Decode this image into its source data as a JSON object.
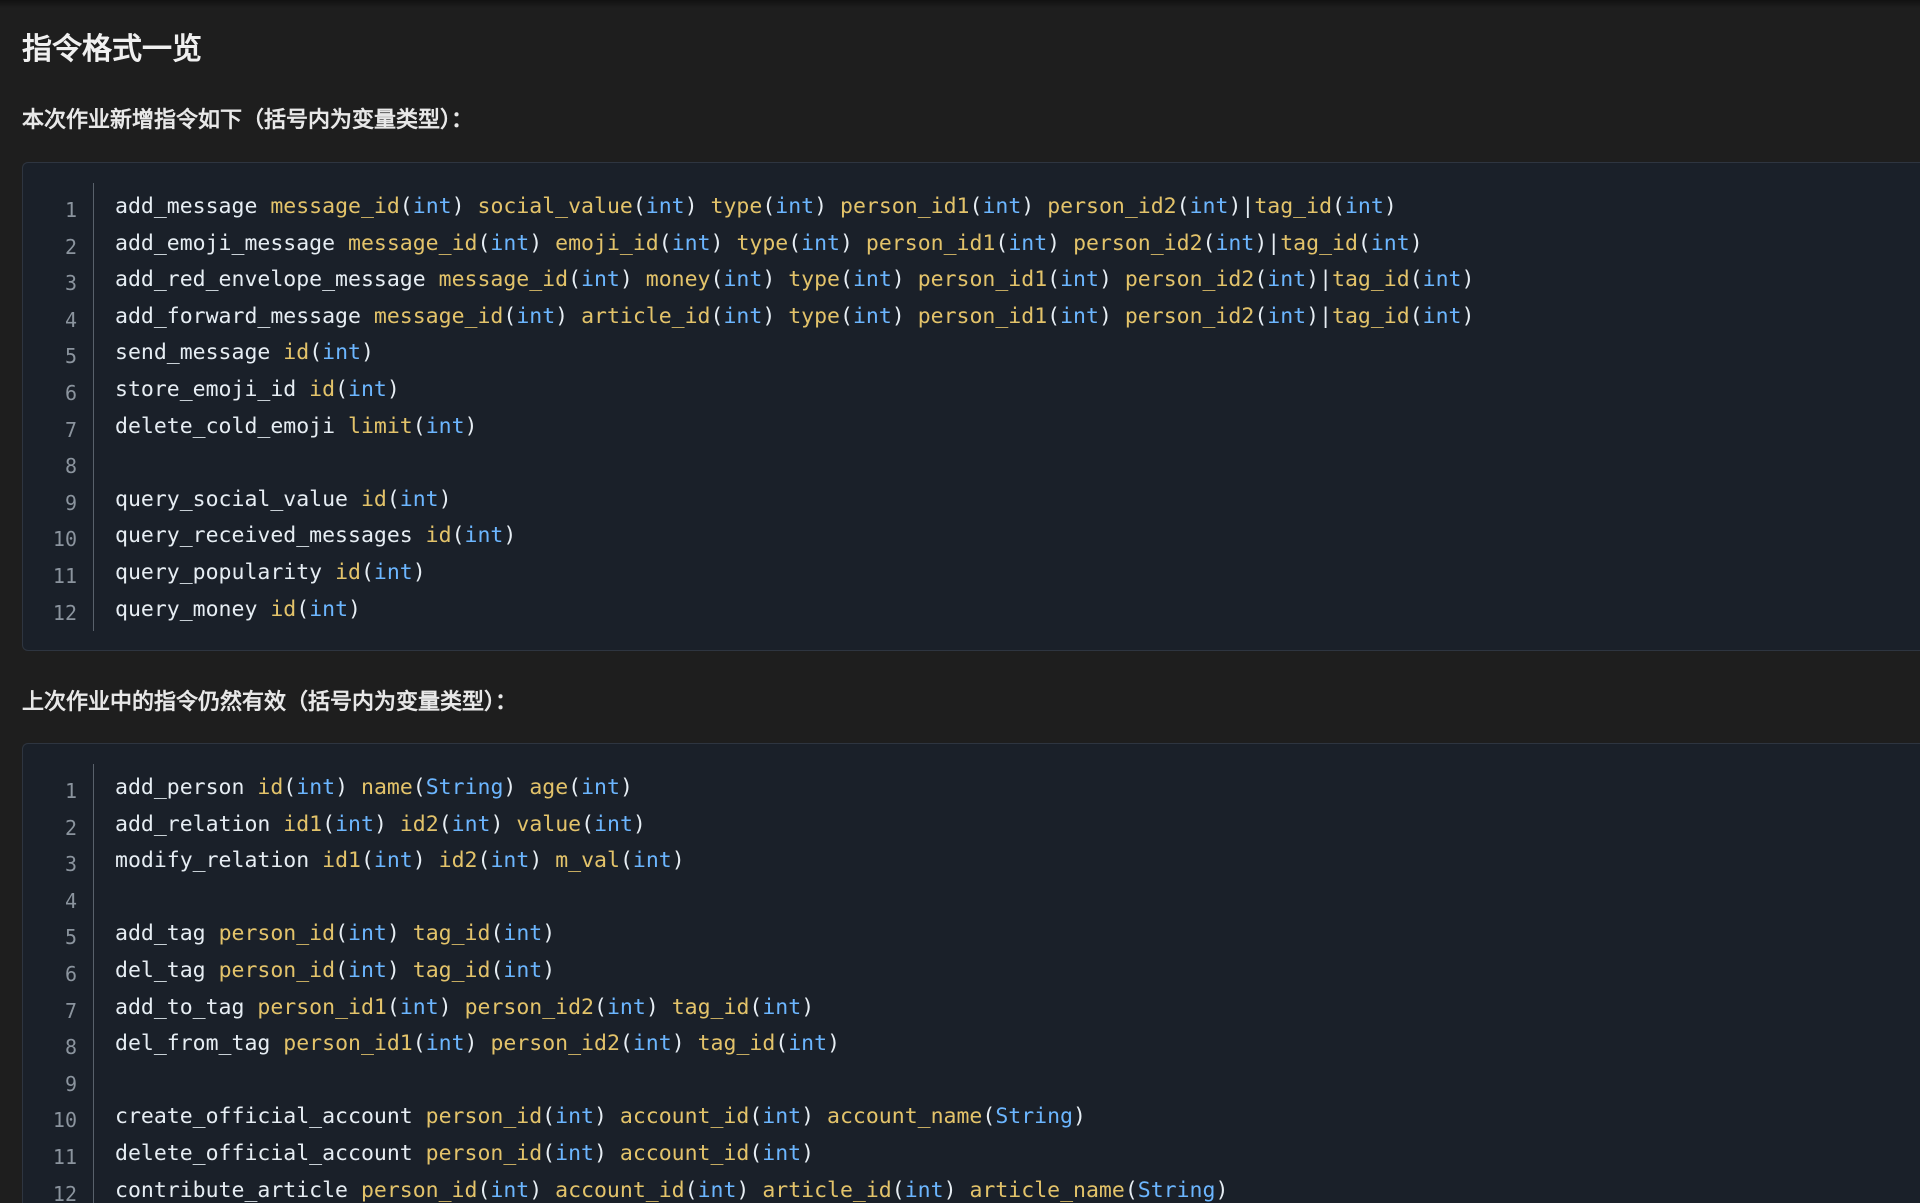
{
  "page": {
    "title": "指令格式一览"
  },
  "sections": [
    {
      "heading": "本次作业新增指令如下（括号内为变量类型）：",
      "lines": [
        {
          "n": "1",
          "cmd": "add_message",
          "args": [
            {
              "sep": " ",
              "name": "message_id",
              "type": "int"
            },
            {
              "sep": " ",
              "name": "social_value",
              "type": "int"
            },
            {
              "sep": " ",
              "name": "type",
              "type": "int"
            },
            {
              "sep": " ",
              "name": "person_id1",
              "type": "int"
            },
            {
              "sep": " ",
              "name": "person_id2",
              "type": "int"
            },
            {
              "sep": "|",
              "name": "tag_id",
              "type": "int"
            }
          ]
        },
        {
          "n": "2",
          "cmd": "add_emoji_message",
          "args": [
            {
              "sep": " ",
              "name": "message_id",
              "type": "int"
            },
            {
              "sep": " ",
              "name": "emoji_id",
              "type": "int"
            },
            {
              "sep": " ",
              "name": "type",
              "type": "int"
            },
            {
              "sep": " ",
              "name": "person_id1",
              "type": "int"
            },
            {
              "sep": " ",
              "name": "person_id2",
              "type": "int"
            },
            {
              "sep": "|",
              "name": "tag_id",
              "type": "int"
            }
          ]
        },
        {
          "n": "3",
          "cmd": "add_red_envelope_message",
          "args": [
            {
              "sep": " ",
              "name": "message_id",
              "type": "int"
            },
            {
              "sep": " ",
              "name": "money",
              "type": "int"
            },
            {
              "sep": " ",
              "name": "type",
              "type": "int"
            },
            {
              "sep": " ",
              "name": "person_id1",
              "type": "int"
            },
            {
              "sep": " ",
              "name": "person_id2",
              "type": "int"
            },
            {
              "sep": "|",
              "name": "tag_id",
              "type": "int"
            }
          ]
        },
        {
          "n": "4",
          "cmd": "add_forward_message",
          "args": [
            {
              "sep": " ",
              "name": "message_id",
              "type": "int"
            },
            {
              "sep": " ",
              "name": "article_id",
              "type": "int"
            },
            {
              "sep": " ",
              "name": "type",
              "type": "int"
            },
            {
              "sep": " ",
              "name": "person_id1",
              "type": "int"
            },
            {
              "sep": " ",
              "name": "person_id2",
              "type": "int"
            },
            {
              "sep": "|",
              "name": "tag_id",
              "type": "int"
            }
          ]
        },
        {
          "n": "5",
          "cmd": "send_message",
          "args": [
            {
              "sep": " ",
              "name": "id",
              "type": "int"
            }
          ]
        },
        {
          "n": "6",
          "cmd": "store_emoji_id",
          "args": [
            {
              "sep": " ",
              "name": "id",
              "type": "int"
            }
          ]
        },
        {
          "n": "7",
          "cmd": "delete_cold_emoji",
          "args": [
            {
              "sep": " ",
              "name": "limit",
              "type": "int"
            }
          ]
        },
        {
          "n": "8",
          "cmd": "",
          "args": []
        },
        {
          "n": "9",
          "cmd": "query_social_value",
          "args": [
            {
              "sep": " ",
              "name": "id",
              "type": "int"
            }
          ]
        },
        {
          "n": "10",
          "cmd": "query_received_messages",
          "args": [
            {
              "sep": " ",
              "name": "id",
              "type": "int"
            }
          ]
        },
        {
          "n": "11",
          "cmd": "query_popularity",
          "args": [
            {
              "sep": " ",
              "name": "id",
              "type": "int"
            }
          ]
        },
        {
          "n": "12",
          "cmd": "query_money",
          "args": [
            {
              "sep": " ",
              "name": "id",
              "type": "int"
            }
          ]
        }
      ]
    },
    {
      "heading": "上次作业中的指令仍然有效（括号内为变量类型）：",
      "lines": [
        {
          "n": "1",
          "cmd": "add_person",
          "args": [
            {
              "sep": " ",
              "name": "id",
              "type": "int"
            },
            {
              "sep": " ",
              "name": "name",
              "type": "String"
            },
            {
              "sep": " ",
              "name": "age",
              "type": "int"
            }
          ]
        },
        {
          "n": "2",
          "cmd": "add_relation",
          "args": [
            {
              "sep": " ",
              "name": "id1",
              "type": "int"
            },
            {
              "sep": " ",
              "name": "id2",
              "type": "int"
            },
            {
              "sep": " ",
              "name": "value",
              "type": "int"
            }
          ]
        },
        {
          "n": "3",
          "cmd": "modify_relation",
          "args": [
            {
              "sep": " ",
              "name": "id1",
              "type": "int"
            },
            {
              "sep": " ",
              "name": "id2",
              "type": "int"
            },
            {
              "sep": " ",
              "name": "m_val",
              "type": "int"
            }
          ]
        },
        {
          "n": "4",
          "cmd": "",
          "args": []
        },
        {
          "n": "5",
          "cmd": "add_tag",
          "args": [
            {
              "sep": " ",
              "name": "person_id",
              "type": "int"
            },
            {
              "sep": " ",
              "name": "tag_id",
              "type": "int"
            }
          ]
        },
        {
          "n": "6",
          "cmd": "del_tag",
          "args": [
            {
              "sep": " ",
              "name": "person_id",
              "type": "int"
            },
            {
              "sep": " ",
              "name": "tag_id",
              "type": "int"
            }
          ]
        },
        {
          "n": "7",
          "cmd": "add_to_tag",
          "args": [
            {
              "sep": " ",
              "name": "person_id1",
              "type": "int"
            },
            {
              "sep": " ",
              "name": "person_id2",
              "type": "int"
            },
            {
              "sep": " ",
              "name": "tag_id",
              "type": "int"
            }
          ]
        },
        {
          "n": "8",
          "cmd": "del_from_tag",
          "args": [
            {
              "sep": " ",
              "name": "person_id1",
              "type": "int"
            },
            {
              "sep": " ",
              "name": "person_id2",
              "type": "int"
            },
            {
              "sep": " ",
              "name": "tag_id",
              "type": "int"
            }
          ]
        },
        {
          "n": "9",
          "cmd": "",
          "args": []
        },
        {
          "n": "10",
          "cmd": "create_official_account",
          "args": [
            {
              "sep": " ",
              "name": "person_id",
              "type": "int"
            },
            {
              "sep": " ",
              "name": "account_id",
              "type": "int"
            },
            {
              "sep": " ",
              "name": "account_name",
              "type": "String"
            }
          ]
        },
        {
          "n": "11",
          "cmd": "delete_official_account",
          "args": [
            {
              "sep": " ",
              "name": "person_id",
              "type": "int"
            },
            {
              "sep": " ",
              "name": "account_id",
              "type": "int"
            }
          ]
        },
        {
          "n": "12",
          "cmd": "contribute_article",
          "args": [
            {
              "sep": " ",
              "name": "person_id",
              "type": "int"
            },
            {
              "sep": " ",
              "name": "account_id",
              "type": "int"
            },
            {
              "sep": " ",
              "name": "article_id",
              "type": "int"
            },
            {
              "sep": " ",
              "name": "article_name",
              "type": "String"
            }
          ]
        }
      ]
    }
  ]
}
